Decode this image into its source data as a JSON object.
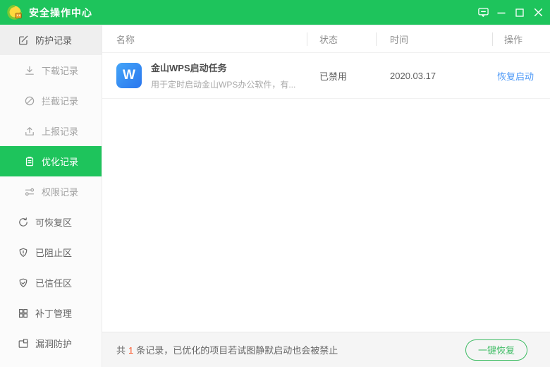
{
  "titlebar": {
    "title": "安全操作中心",
    "logo_icon": "duba-logo-icon",
    "control_icons": [
      "feedback-icon",
      "minimize-icon",
      "maximize-icon",
      "close-icon"
    ]
  },
  "sidebar": {
    "items": [
      {
        "label": "防护记录",
        "icon": "edit-icon",
        "level": "top",
        "selected": false
      },
      {
        "label": "下载记录",
        "icon": "download-icon",
        "level": "sub",
        "selected": false
      },
      {
        "label": "拦截记录",
        "icon": "block-icon",
        "level": "sub",
        "selected": false
      },
      {
        "label": "上报记录",
        "icon": "upload-icon",
        "level": "sub",
        "selected": false
      },
      {
        "label": "优化记录",
        "icon": "clipboard-icon",
        "level": "sub",
        "selected": true
      },
      {
        "label": "权限记录",
        "icon": "sliders-icon",
        "level": "sub",
        "selected": false
      },
      {
        "label": "可恢复区",
        "icon": "restore-icon",
        "level": "top",
        "selected": false
      },
      {
        "label": "已阻止区",
        "icon": "shield-exclamation-icon",
        "level": "top",
        "selected": false
      },
      {
        "label": "已信任区",
        "icon": "shield-check-icon",
        "level": "top",
        "selected": false
      },
      {
        "label": "补丁管理",
        "icon": "patch-grid-icon",
        "level": "top",
        "selected": false
      },
      {
        "label": "漏洞防护",
        "icon": "vulnerability-icon",
        "level": "top",
        "selected": false
      }
    ]
  },
  "table": {
    "columns": [
      "名称",
      "状态",
      "时间",
      "操作"
    ],
    "rows": [
      {
        "icon": "wps-icon",
        "icon_letter": "W",
        "name": "金山WPS启动任务",
        "description": "用于定时启动金山WPS办公软件，有...",
        "status": "已禁用",
        "time": "2020.03.17",
        "action": "恢复启动"
      }
    ]
  },
  "footer": {
    "summary_prefix": "共",
    "count": "1",
    "summary_suffix": "条记录，已优化的项目若试图静默启动也会被禁止",
    "button_label": "一键恢复"
  },
  "colors": {
    "brand_green": "#1ec45c",
    "button_green": "#3ebc64",
    "link_blue": "#4f9af7",
    "count_red": "#fb5a2d",
    "wps_blue": "#2a76ee",
    "sidebar_bg": "#fbfbfb",
    "footer_bg": "#f5f5f5"
  }
}
